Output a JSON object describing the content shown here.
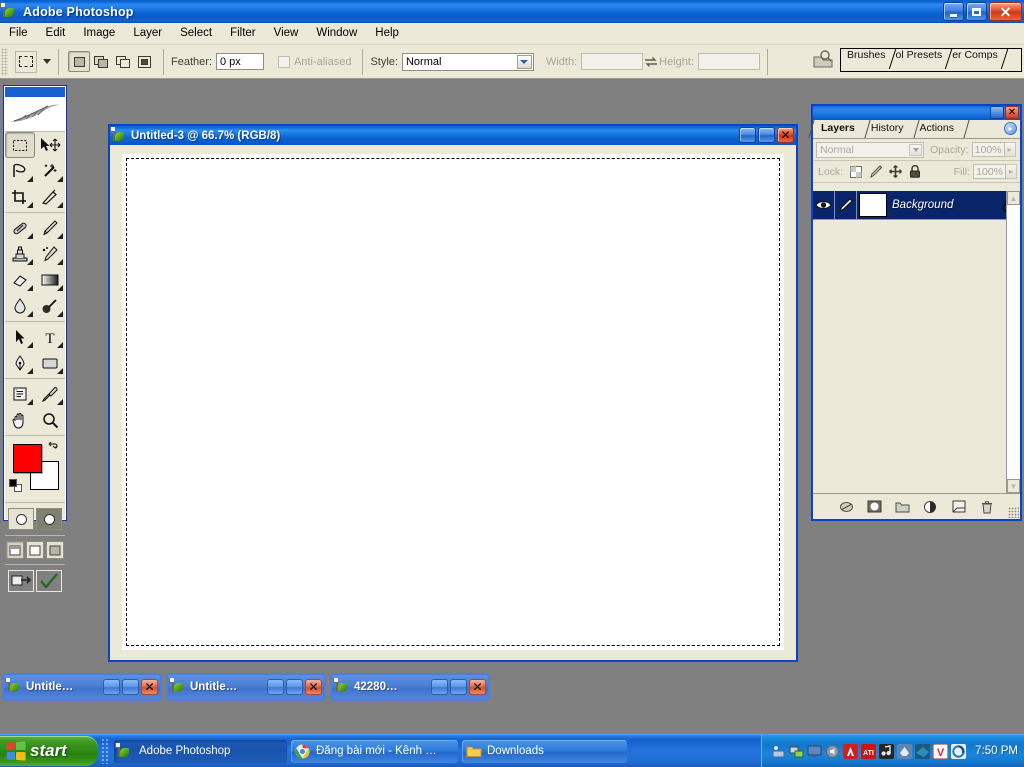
{
  "app": {
    "title": "Adobe Photoshop",
    "window_buttons": {
      "minimize": "Minimize",
      "restore": "Restore",
      "close": "Close"
    }
  },
  "menubar": {
    "items": [
      {
        "label": "File"
      },
      {
        "label": "Edit"
      },
      {
        "label": "Image"
      },
      {
        "label": "Layer"
      },
      {
        "label": "Select"
      },
      {
        "label": "Filter"
      },
      {
        "label": "View"
      },
      {
        "label": "Window"
      },
      {
        "label": "Help"
      }
    ]
  },
  "options_bar": {
    "tool_preset_icon": "rectangular-marquee-icon",
    "selection_modes": [
      {
        "name": "new-selection",
        "active": true
      },
      {
        "name": "add-to-selection",
        "active": false
      },
      {
        "name": "subtract-from-selection",
        "active": false
      },
      {
        "name": "intersect-with-selection",
        "active": false
      }
    ],
    "feather_label": "Feather:",
    "feather_value": "0 px",
    "antialiased_label": "Anti-aliased",
    "antialiased_checked": false,
    "style_label": "Style:",
    "style_value": "Normal",
    "width_label": "Width:",
    "width_value": "",
    "height_label": "Height:",
    "height_value": "",
    "swap_icon": "swap-width-height-icon",
    "dock_icon": "palette-dock-icon",
    "palette_well": [
      {
        "label": "Brushes"
      },
      {
        "label": "ol Presets"
      },
      {
        "label": "er Comps"
      }
    ]
  },
  "toolbox": {
    "tools": [
      {
        "name": "rectangular-marquee-tool",
        "active": true,
        "has_flyout": false
      },
      {
        "name": "move-tool",
        "active": false,
        "has_flyout": false
      },
      {
        "name": "lasso-tool",
        "active": false,
        "has_flyout": true
      },
      {
        "name": "magic-wand-tool",
        "active": false,
        "has_flyout": true
      },
      {
        "name": "crop-tool",
        "active": false,
        "has_flyout": true
      },
      {
        "name": "slice-tool",
        "active": false,
        "has_flyout": true
      },
      {
        "name": "healing-brush-tool",
        "active": false,
        "has_flyout": true
      },
      {
        "name": "brush-tool",
        "active": false,
        "has_flyout": true
      },
      {
        "name": "clone-stamp-tool",
        "active": false,
        "has_flyout": true
      },
      {
        "name": "history-brush-tool",
        "active": false,
        "has_flyout": true
      },
      {
        "name": "eraser-tool",
        "active": false,
        "has_flyout": true
      },
      {
        "name": "gradient-tool",
        "active": false,
        "has_flyout": true
      },
      {
        "name": "blur-tool",
        "active": false,
        "has_flyout": true
      },
      {
        "name": "dodge-tool",
        "active": false,
        "has_flyout": true
      },
      {
        "name": "path-selection-tool",
        "active": false,
        "has_flyout": true
      },
      {
        "name": "type-tool",
        "active": false,
        "has_flyout": true
      },
      {
        "name": "pen-tool",
        "active": false,
        "has_flyout": true
      },
      {
        "name": "rectangle-shape-tool",
        "active": false,
        "has_flyout": true
      },
      {
        "name": "notes-tool",
        "active": false,
        "has_flyout": true
      },
      {
        "name": "eyedropper-tool",
        "active": false,
        "has_flyout": true
      },
      {
        "name": "hand-tool",
        "active": false,
        "has_flyout": false
      },
      {
        "name": "zoom-tool",
        "active": false,
        "has_flyout": false
      }
    ],
    "foreground_color": "#FF0000",
    "background_color": "#FFFFFF",
    "default_colors_icon": "default-colors-icon",
    "swap_colors_icon": "swap-colors-icon",
    "quickmask": [
      {
        "name": "standard-mode-button",
        "active": true
      },
      {
        "name": "quick-mask-mode-button",
        "active": false
      }
    ],
    "screen_modes": [
      {
        "name": "standard-screen-mode-button",
        "active": true
      },
      {
        "name": "full-screen-with-menubar-button",
        "active": false
      },
      {
        "name": "full-screen-mode-button",
        "active": false
      }
    ],
    "jump_to": [
      {
        "name": "jump-to-imageready-button"
      },
      {
        "name": "check-button"
      }
    ]
  },
  "document": {
    "title": "Untitled-3 @ 66.7% (RGB/8)",
    "zoom": "66.7%",
    "color_mode": "RGB/8",
    "has_selection": true
  },
  "layers_palette": {
    "tabs": [
      {
        "label": "Layers",
        "active": true
      },
      {
        "label": "History",
        "active": false
      },
      {
        "label": "Actions",
        "active": false
      }
    ],
    "menu_icon": "palette-menu-icon",
    "blend_mode": "Normal",
    "opacity_label": "Opacity:",
    "opacity_value": "100%",
    "lock_label": "Lock:",
    "lock_icons": [
      {
        "name": "lock-transparent-pixels-icon"
      },
      {
        "name": "lock-image-pixels-icon"
      },
      {
        "name": "lock-position-icon"
      },
      {
        "name": "lock-all-icon"
      }
    ],
    "fill_label": "Fill:",
    "fill_value": "100%",
    "layers": [
      {
        "name": "Background",
        "visible": true,
        "locked": true,
        "selected": true,
        "eye_icon": "eye-icon",
        "brush_icon": "layer-active-brush-icon",
        "lock_icon": "lock-icon"
      }
    ],
    "footer_buttons": [
      {
        "name": "link-layers-button"
      },
      {
        "name": "layer-style-button"
      },
      {
        "name": "add-layer-mask-button"
      },
      {
        "name": "new-adjustment-layer-button"
      },
      {
        "name": "new-layer-set-button"
      },
      {
        "name": "new-layer-button"
      },
      {
        "name": "delete-layer-button"
      }
    ]
  },
  "minimized_documents": [
    {
      "title": "Untitle…",
      "icon": "photoshop-document-icon"
    },
    {
      "title": "Untitle…",
      "icon": "photoshop-document-icon"
    },
    {
      "title": "42280…",
      "icon": "photoshop-document-icon"
    }
  ],
  "taskbar": {
    "start_label": "start",
    "buttons": [
      {
        "label": "Adobe Photoshop",
        "icon": "photoshop-icon",
        "active": true
      },
      {
        "label": "Đăng bài mới - Kênh …",
        "icon": "chrome-icon",
        "active": false
      },
      {
        "label": "Downloads",
        "icon": "folder-icon",
        "active": false
      }
    ],
    "tray_icons": [
      {
        "name": "safely-remove-hardware-icon",
        "color": "#2f6fae"
      },
      {
        "name": "network-icon",
        "color": "#3c8a3c"
      },
      {
        "name": "display-settings-icon",
        "color": "#4a6fa8"
      },
      {
        "name": "volume-icon",
        "color": "#7b8a99"
      },
      {
        "name": "avast-antivirus-icon",
        "color": "#cf2020"
      },
      {
        "name": "ati-catalyst-icon",
        "color": "#cc1414"
      },
      {
        "name": "media-player-icon",
        "color": "#2b2b2b"
      },
      {
        "name": "unikey-icon",
        "color": "#6b8fb8"
      },
      {
        "name": "teamviewer-icon",
        "color": "#1b5a7a"
      },
      {
        "name": "v-app-icon",
        "color": "#d42a2a"
      },
      {
        "name": "idm-icon",
        "color": "#1e7ab8"
      }
    ],
    "clock": "7:50 PM"
  }
}
